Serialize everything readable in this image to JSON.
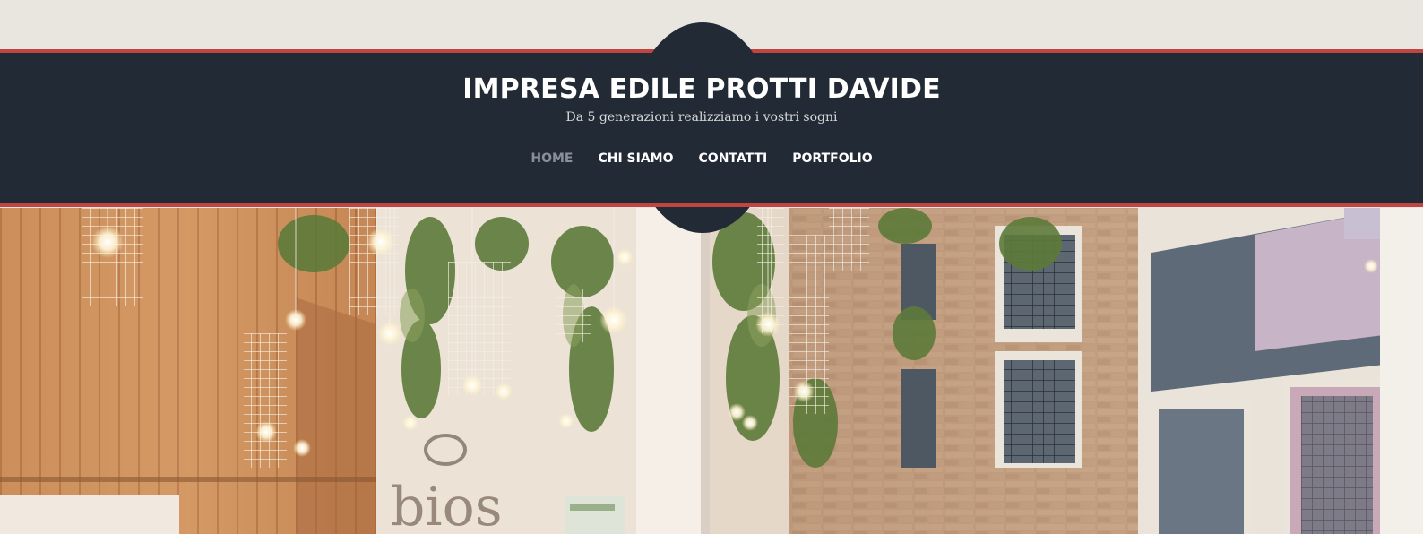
{
  "header": {
    "site_title": "IMPRESA EDILE PROTTI DAVIDE",
    "tagline": "Da 5 generazioni realizziamo i vostri sogni"
  },
  "nav": {
    "items": [
      {
        "label": "HOME",
        "active": true
      },
      {
        "label": "CHI SIAMO",
        "active": false
      },
      {
        "label": "CONTATTI",
        "active": false
      },
      {
        "label": "PORTFOLIO",
        "active": false
      }
    ]
  },
  "hero": {
    "sign_text": "bios"
  },
  "colors": {
    "band": "#222a35",
    "accent_line": "#c0443f",
    "page_background": "#e9e5df",
    "nav_active": "#8a9099"
  }
}
